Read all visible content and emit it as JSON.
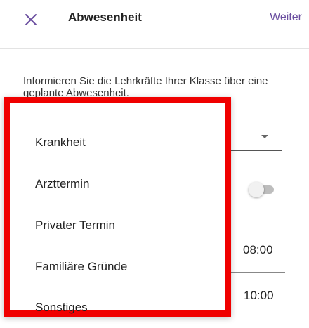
{
  "header": {
    "title": "Abwesenheit",
    "next_label": "Weiter"
  },
  "info_text": "Informieren Sie die Lehrkräfte Ihrer Klasse über eine geplante Abwesenheit.",
  "form": {
    "toggle_on": false,
    "time_start": "08:00",
    "time_end": "10:00"
  },
  "dropdown": {
    "options": [
      "Krankheit",
      "Arzttermin",
      "Privater Termin",
      "Familiäre Gründe",
      "Sonstiges"
    ]
  },
  "colors": {
    "accent": "#6b4fa0",
    "highlight": "#f00000"
  }
}
